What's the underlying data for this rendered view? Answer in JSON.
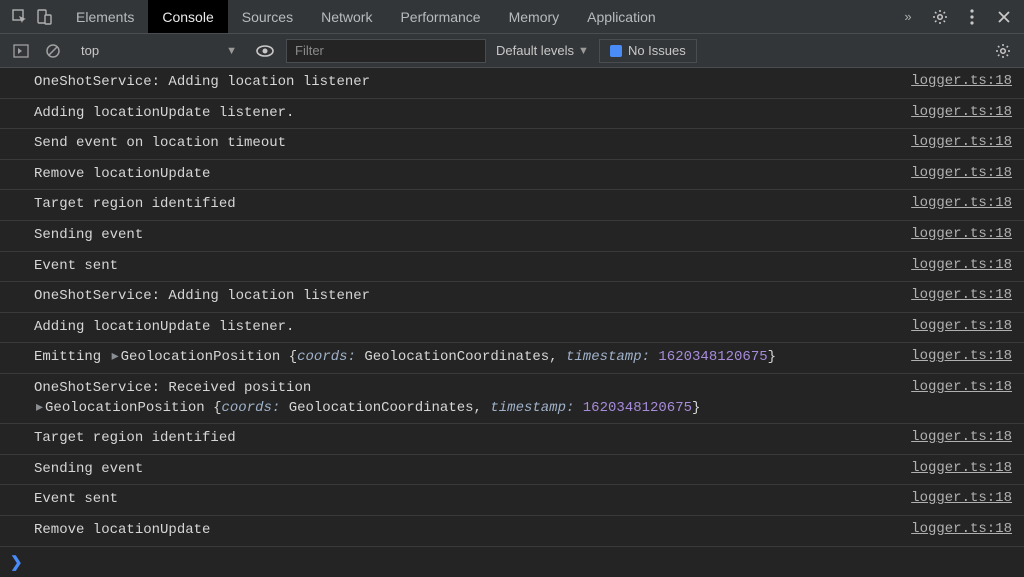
{
  "tabs": [
    "Elements",
    "Console",
    "Sources",
    "Network",
    "Performance",
    "Memory",
    "Application"
  ],
  "activeTab": 1,
  "toolbar": {
    "context": "top",
    "filterPlaceholder": "Filter",
    "levels": "Default levels",
    "issues": "No Issues"
  },
  "source": "logger.ts:18",
  "logs": [
    {
      "text": "OneShotService: Adding location listener"
    },
    {
      "text": "Adding locationUpdate listener."
    },
    {
      "text": "Send event on location timeout"
    },
    {
      "text": "Remove locationUpdate"
    },
    {
      "text": "Target region identified"
    },
    {
      "text": "Sending event"
    },
    {
      "text": "Event sent"
    },
    {
      "text": "OneShotService: Adding location listener"
    },
    {
      "text": "Adding locationUpdate listener."
    },
    {
      "type": "geo",
      "prefix": "Emitting ",
      "cls": "GeolocationPosition",
      "k1": "coords",
      "v1": "GeolocationCoordinates",
      "k2": "timestamp",
      "v2": "1620348120675"
    },
    {
      "type": "geo2",
      "line1": "OneShotService: Received position",
      "cls": "GeolocationPosition",
      "k1": "coords",
      "v1": "GeolocationCoordinates",
      "k2": "timestamp",
      "v2": "1620348120675"
    },
    {
      "text": "Target region identified"
    },
    {
      "text": "Sending event"
    },
    {
      "text": "Event sent"
    },
    {
      "text": "Remove locationUpdate"
    }
  ],
  "prompt": "❯"
}
